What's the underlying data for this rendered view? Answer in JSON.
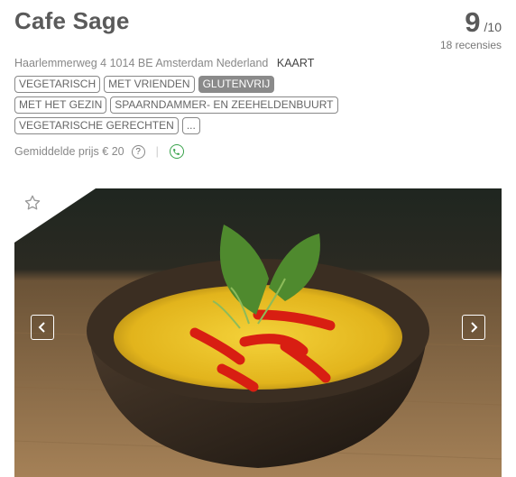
{
  "restaurant": {
    "name": "Cafe Sage",
    "score": "9",
    "score_max": "/10",
    "reviews": "18 recensies",
    "address": "Haarlemmerweg 4 1014 BE Amsterdam Nederland",
    "map_label": "KAART",
    "price": "Gemiddelde prijs € 20"
  },
  "tags": {
    "row1": [
      "VEGETARISCH",
      "MET VRIENDEN",
      "GLUTENVRIJ"
    ],
    "row2": [
      "MET HET GEZIN",
      "SPAARNDAMMER- EN ZEEHELDENBUURT"
    ],
    "row3": [
      "VEGETARISCHE GERECHTEN",
      "..."
    ],
    "active": "GLUTENVRIJ"
  },
  "icons": {
    "help": "question-circle-icon",
    "phone": "phone-icon",
    "favorite": "star-outline-icon",
    "prev": "chevron-left-icon",
    "next": "chevron-right-icon"
  },
  "colors": {
    "phone_accent": "#38a24a",
    "active_tag_bg": "#8a8a8a"
  }
}
